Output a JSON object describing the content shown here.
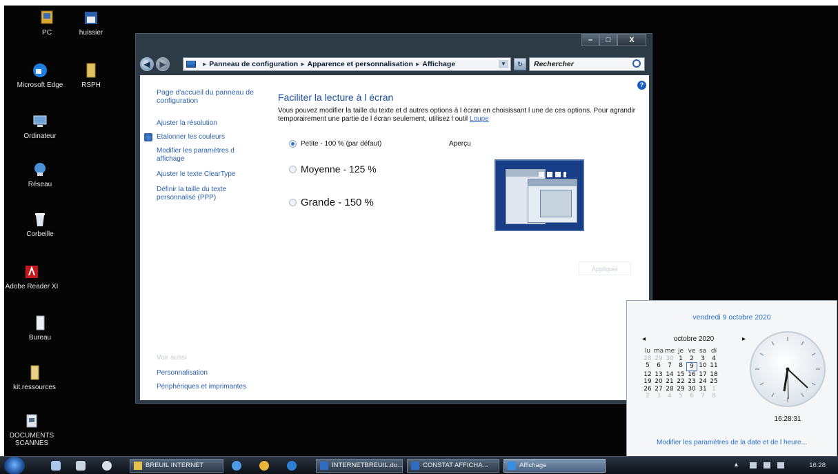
{
  "desktop_icons": [
    {
      "label": "PC",
      "icon": "computer-icon"
    },
    {
      "label": "huissier",
      "icon": "folder-shortcut-icon"
    },
    {
      "label": "Microsoft Edge",
      "icon": "edge-icon"
    },
    {
      "label": "RSPH",
      "icon": "folder-icon"
    },
    {
      "label": "Ordinateur",
      "icon": "computer-icon"
    },
    {
      "label": "Réseau",
      "icon": "network-icon"
    },
    {
      "label": "Corbeille",
      "icon": "recycle-bin-icon"
    },
    {
      "label": "Adobe Reader XI",
      "icon": "adobe-reader-icon"
    },
    {
      "label": "Bureau",
      "icon": "folder-icon"
    },
    {
      "label": "kit.ressources",
      "icon": "folder-icon"
    },
    {
      "label": "DOCUMENTS SCANNES",
      "icon": "scanner-folder-icon"
    }
  ],
  "window": {
    "buttons": {
      "minimize": "–",
      "maximize": "□",
      "close": "X"
    },
    "address": {
      "parts": [
        "Panneau de configuration",
        "Apparence et personnalisation",
        "Affichage"
      ],
      "sep": "▸"
    },
    "search_placeholder": "Rechercher",
    "left_pane": {
      "home": "Page d'accueil du panneau de configuration",
      "links": [
        "Ajuster la résolution",
        "Etalonner les couleurs",
        "Modifier les paramètres d affichage",
        "Ajuster le texte ClearType",
        "Définir la taille du texte personnalisé (PPP)"
      ],
      "see_also": "Voir aussi",
      "see_also_links": [
        "Personnalisation",
        "Périphériques et imprimantes"
      ]
    },
    "main": {
      "title": "Faciliter la lecture à l écran",
      "description": "Vous pouvez modifier la taille du texte et d autres options à l écran en choisissant l une de ces options. Pour agrandir temporairement une partie de l écran seulement, utilisez l outil",
      "loupe_link": "Loupe",
      "options": [
        {
          "label": "Petite - 100 % (par défaut)",
          "selected": true
        },
        {
          "label": "Moyenne - 125 %",
          "selected": false
        },
        {
          "label": "Grande - 150 %",
          "selected": false
        }
      ],
      "preview_label": "Aperçu",
      "apply": "Appliquer"
    }
  },
  "calendar": {
    "header": "vendredi 9 octobre 2020",
    "month": "octobre 2020",
    "days": [
      "lu",
      "ma",
      "me",
      "je",
      "ve",
      "sa",
      "di"
    ],
    "weeks": [
      [
        "28",
        "29",
        "30",
        "1",
        "2",
        "3",
        "4"
      ],
      [
        "5",
        "6",
        "7",
        "8",
        "9",
        "10",
        "11"
      ],
      [
        "12",
        "13",
        "14",
        "15",
        "16",
        "17",
        "18"
      ],
      [
        "19",
        "20",
        "21",
        "22",
        "23",
        "24",
        "25"
      ],
      [
        "26",
        "27",
        "28",
        "29",
        "30",
        "31",
        "1"
      ],
      [
        "2",
        "3",
        "4",
        "5",
        "6",
        "7",
        "8"
      ]
    ],
    "selected_day": "9",
    "time": "16:28:31",
    "link": "Modifier les paramètres de la date et de l heure..."
  },
  "taskbar": {
    "buttons": [
      {
        "label": "BREUIL INTERNET",
        "active": false
      },
      {
        "label": "INTERNETBREUIL.do...",
        "active": false
      },
      {
        "label": "CONSTAT AFFICHA...",
        "active": false
      },
      {
        "label": "Affichage",
        "active": true
      }
    ],
    "clock": "16:28"
  },
  "colors": {
    "accent": "#1c4fa5",
    "link": "#2a5fb0",
    "taskbar": "#1a2230"
  }
}
